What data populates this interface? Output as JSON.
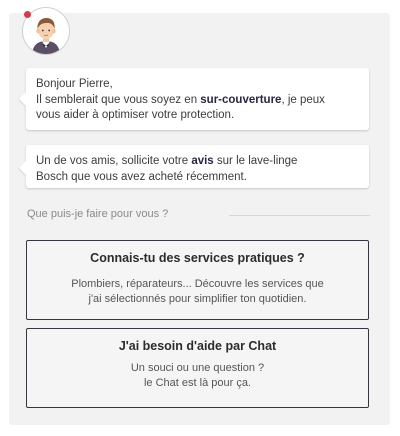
{
  "avatar": {
    "icon": "butler-avatar-icon",
    "notification_color": "#d8384a"
  },
  "messages": {
    "m1": {
      "line1": "Bonjour Pierre,",
      "line2_before": "Il semblerait que vous soyez en ",
      "line2_bold": "sur-couverture",
      "line2_after": ", je peux",
      "line3": "vous aider à optimiser votre protection."
    },
    "m2": {
      "line1_before": "Un de vos amis, sollicite votre ",
      "line1_bold": "avis",
      "line1_after": " sur le lave-linge",
      "line2": "Bosch que vous avez acheté récemment."
    }
  },
  "prompt": {
    "label": "Que puis-je faire pour vous ?"
  },
  "cards": {
    "services": {
      "title": "Connais-tu des services pratiques ?",
      "desc_line1": "Plombiers, réparateurs... Découvre les services que",
      "desc_line2": "j'ai sélectionnés pour simplifier ton quotidien."
    },
    "chat": {
      "title": "J'ai besoin d'aide par Chat",
      "desc_line1": "Un souci ou une question ?",
      "desc_line2": "le Chat est là pour ça."
    }
  },
  "colors": {
    "panel": "#f2f2f2",
    "card_border": "#3a3340",
    "accent_dot": "#d8384a"
  }
}
